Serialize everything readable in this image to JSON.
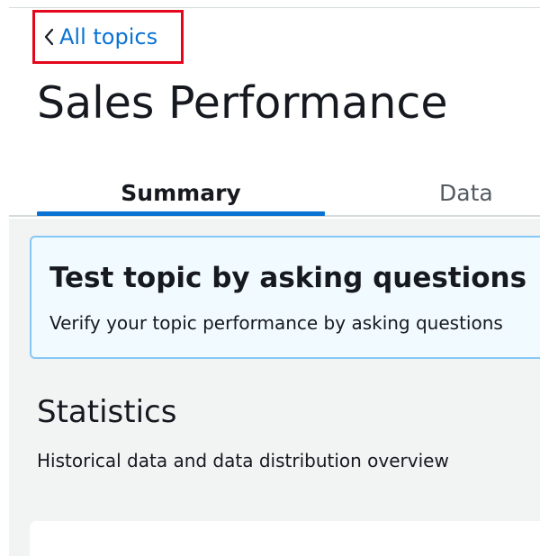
{
  "nav": {
    "back_label": "All topics",
    "back_icon": "chevron-left-icon"
  },
  "page": {
    "title": "Sales Performance"
  },
  "tabs": [
    {
      "label": "Summary",
      "selected": true
    },
    {
      "label": "Data",
      "selected": false
    }
  ],
  "banner": {
    "title": "Test topic by asking questions",
    "text": "Verify your topic performance by asking questions"
  },
  "statistics": {
    "heading": "Statistics",
    "description": "Historical data and data distribution overview"
  },
  "colors": {
    "link": "#0972d3",
    "highlight_box": "#e3061c",
    "banner_bg": "#f1faff",
    "banner_border": "#85c7f5",
    "content_bg": "#f2f3f3"
  }
}
